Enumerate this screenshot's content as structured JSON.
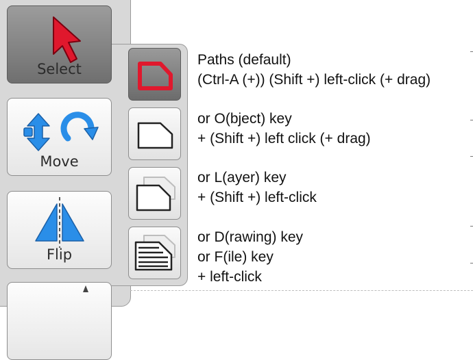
{
  "tools": {
    "select": {
      "label": "Select"
    },
    "move": {
      "label": "Move"
    },
    "flip": {
      "label": "Flip"
    }
  },
  "selection_modes": [
    {
      "id": "paths",
      "lines": [
        "Paths (default)",
        "(Ctrl-A (+)) (Shift +) left-click (+ drag)"
      ]
    },
    {
      "id": "object",
      "lines": [
        "or O(bject) key",
        "+ (Shift +) left click (+ drag)"
      ]
    },
    {
      "id": "layer",
      "lines": [
        "or L(ayer) key",
        "+ (Shift +) left-click"
      ]
    },
    {
      "id": "drawing",
      "lines": [
        "or D(rawing) key",
        "or F(ile) key",
        "+ left-click"
      ]
    }
  ],
  "colors": {
    "active_path": "#e0182d",
    "select_arrow": "#e0182d",
    "move_arrows": "#2a8ee8",
    "flip_triangles": "#2a8ee8"
  }
}
